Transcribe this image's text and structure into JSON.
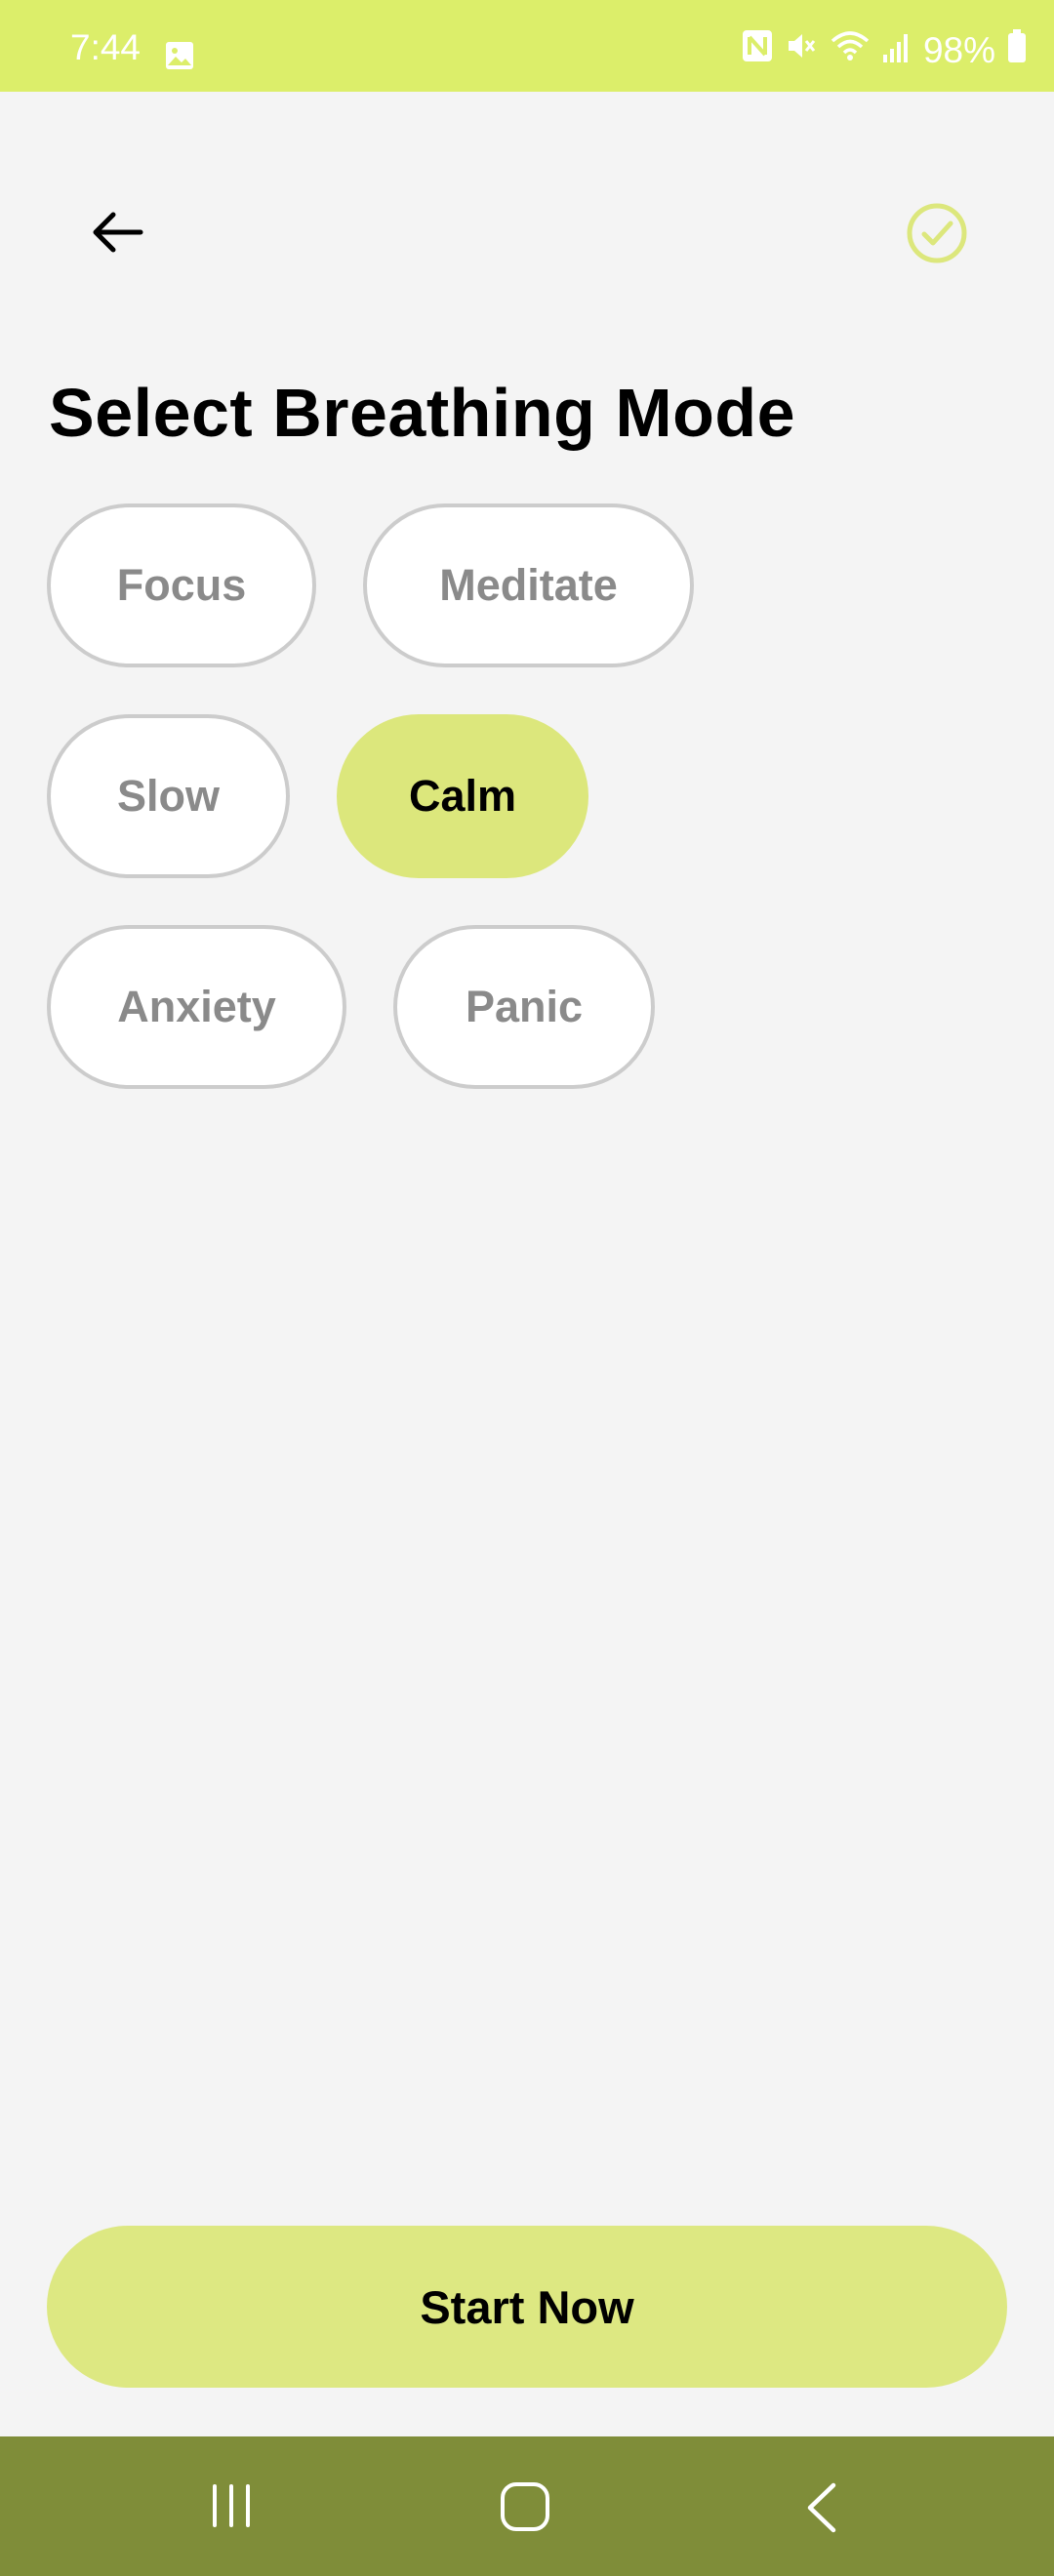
{
  "status_bar": {
    "time": "7:44",
    "battery": "98%",
    "icons": [
      "image-icon",
      "nfc-icon",
      "mute-icon",
      "wifi-icon",
      "signal-icon",
      "battery-icon"
    ]
  },
  "header": {
    "back_icon": "arrow-left-icon",
    "confirm_icon": "check-circle-icon"
  },
  "title": "Select Breathing Mode",
  "modes": [
    {
      "label": "Focus",
      "selected": false
    },
    {
      "label": "Meditate",
      "selected": false
    },
    {
      "label": "Slow",
      "selected": false
    },
    {
      "label": "Calm",
      "selected": true
    },
    {
      "label": "Anxiety",
      "selected": false
    },
    {
      "label": "Panic",
      "selected": false
    }
  ],
  "start_button": "Start Now",
  "nav_bar": {
    "icons": [
      "recents-icon",
      "home-icon",
      "back-icon"
    ]
  },
  "colors": {
    "accent": "#dce77c",
    "status_bar": "#dcee6a",
    "nav_bar": "#7f8d39",
    "background": "#f4f4f4"
  }
}
